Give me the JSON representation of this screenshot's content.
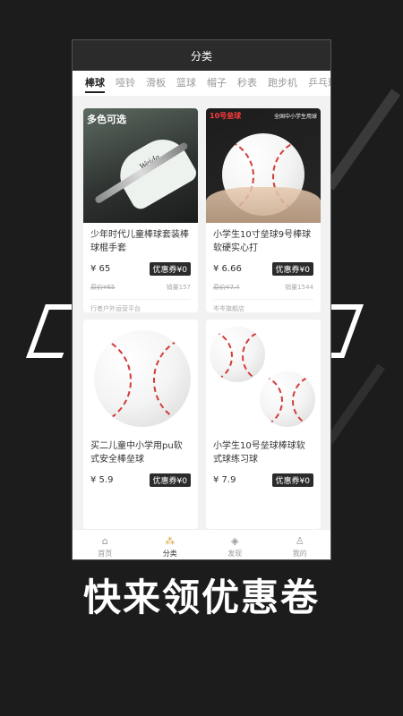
{
  "header": {
    "title": "分类"
  },
  "tabs": [
    {
      "label": "棒球",
      "active": true
    },
    {
      "label": "哑铃",
      "active": false
    },
    {
      "label": "滑板",
      "active": false
    },
    {
      "label": "篮球",
      "active": false
    },
    {
      "label": "帽子",
      "active": false
    },
    {
      "label": "秒表",
      "active": false
    },
    {
      "label": "跑步机",
      "active": false
    },
    {
      "label": "乒乓球",
      "active": false
    }
  ],
  "products": [
    {
      "image_tag": "多色可选",
      "image_text": "Weida",
      "name": "少年时代儿童棒球套装棒球棍手套",
      "price": "¥ 65",
      "coupon": "优惠券¥0",
      "original": "原价¥65",
      "sales": "销量157",
      "shop": "行者户外运营平台"
    },
    {
      "image_tag": "10号垒球",
      "image_note": "全国中小学生用球",
      "name": "小学生10寸垒球9号棒球软硬实心打",
      "price": "¥ 6.66",
      "coupon": "优惠券¥0",
      "original": "原价¥7.4",
      "sales": "销量1544",
      "shop": "岑岑旗舰店"
    },
    {
      "name": "买二儿童中小学用pu软式安全棒垒球",
      "price": "¥ 5.9",
      "coupon": "优惠券¥0"
    },
    {
      "name": "小学生10号垒球棒球软式球练习球",
      "price": "¥ 7.9",
      "coupon": "优惠券¥0"
    }
  ],
  "nav": [
    {
      "label": "首页",
      "icon": "home-icon",
      "glyph": "⌂"
    },
    {
      "label": "分类",
      "icon": "category-icon",
      "glyph": "⁂"
    },
    {
      "label": "发现",
      "icon": "discover-icon",
      "glyph": "◈"
    },
    {
      "label": "我的",
      "icon": "profile-icon",
      "glyph": "♙"
    }
  ],
  "system": {
    "menu": "☰",
    "home": "▢",
    "back": "◁"
  },
  "caption": "快来领优惠卷",
  "colors": {
    "accent": "#d4a53c",
    "dark": "#2b2b2b",
    "background": "#1c1c1c"
  }
}
